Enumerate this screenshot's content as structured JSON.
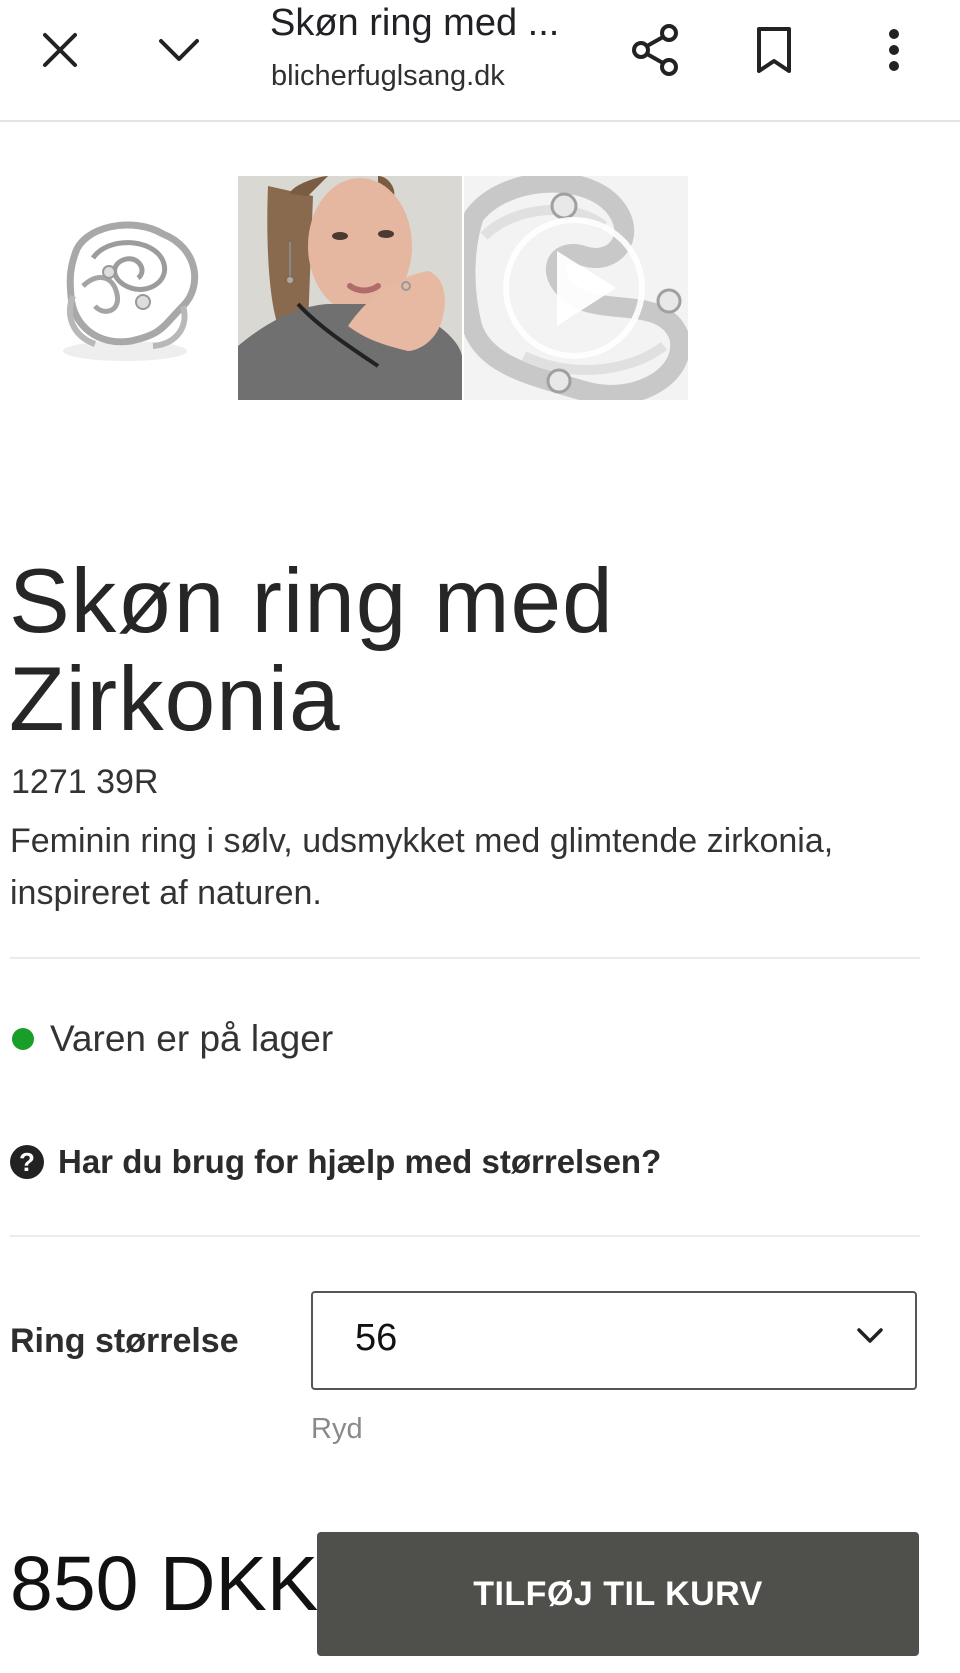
{
  "browser_bar": {
    "title": "Skøn ring med ...",
    "url": "blicherfuglsang.dk",
    "icons": [
      "close-icon",
      "chevron-down-icon",
      "share-icon",
      "bookmark-icon",
      "more-vert-icon"
    ]
  },
  "gallery": {
    "thumbnails": [
      "ring-product-image",
      "model-wearing-jewelry-image",
      "ring-closeup-video"
    ],
    "video_icon": "play-icon"
  },
  "product": {
    "title_line1": "Skøn ring med",
    "title_line2": "Zirkonia",
    "sku": "1271 39R",
    "description": "Feminin ring i sølv, udsmykket med glimtende zirkonia, inspireret af naturen.",
    "stock_status": "Varen er på lager",
    "stock_color": "#1a9e2a",
    "size_help": "Har du brug for hjælp med størrelsen?",
    "size_help_icon": "question-circle-icon",
    "size_label": "Ring størrelse",
    "size_selected": "56",
    "clear_label": "Ryd",
    "price": "850 DKK",
    "add_to_cart": "TILFØJ TIL KURV",
    "cart_button_color": "#4f4f4c"
  }
}
